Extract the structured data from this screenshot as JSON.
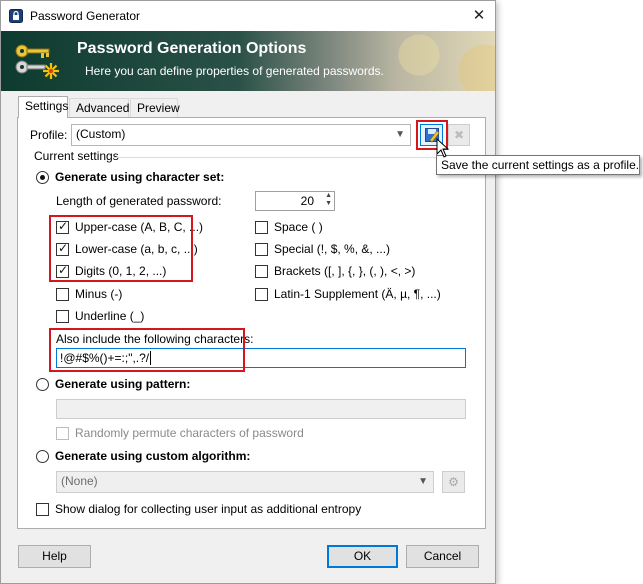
{
  "window": {
    "title": "Password Generator"
  },
  "banner": {
    "title": "Password Generation Options",
    "subtitle": "Here you can define properties of generated passwords."
  },
  "tabs": [
    {
      "label": "Settings",
      "active": true
    },
    {
      "label": "Advanced",
      "active": false
    },
    {
      "label": "Preview",
      "active": false
    }
  ],
  "profile": {
    "label": "Profile:",
    "value": "(Custom)"
  },
  "tooltip": "Save the current settings as a profile.",
  "current_settings": "Current settings",
  "charset": {
    "radio_label": "Generate using character set:",
    "length_label": "Length of generated password:",
    "length_value": "20",
    "options_left": [
      {
        "label": "Upper-case (A, B, C, ...)",
        "checked": true
      },
      {
        "label": "Lower-case (a, b, c, ...)",
        "checked": true
      },
      {
        "label": "Digits (0, 1, 2, ...)",
        "checked": true
      },
      {
        "label": "Minus (-)",
        "checked": false
      },
      {
        "label": "Underline (_)",
        "checked": false
      }
    ],
    "options_right": [
      {
        "label": "Space ( )",
        "checked": false
      },
      {
        "label": "Special (!, $, %, &, ...)",
        "checked": false
      },
      {
        "label": "Brackets ([, ], {, }, (, ), <, >)",
        "checked": false
      },
      {
        "label": "Latin-1 Supplement (Ä, µ, ¶, ...)",
        "checked": false
      }
    ],
    "include_label": "Also include the following characters:",
    "include_value": "!@#$%()+=:;\",.?/"
  },
  "pattern": {
    "radio_label": "Generate using pattern:",
    "value": "",
    "permute_label": "Randomly permute characters of password"
  },
  "custom": {
    "radio_label": "Generate using custom algorithm:",
    "value": "(None)"
  },
  "entropy_label": "Show dialog for collecting user input as additional entropy",
  "buttons": {
    "help": "Help",
    "ok": "OK",
    "cancel": "Cancel"
  },
  "colors": {
    "highlight_box": "#d4171f",
    "banner_dark": "#0e3b2f",
    "focus_blue": "#0078d7"
  }
}
